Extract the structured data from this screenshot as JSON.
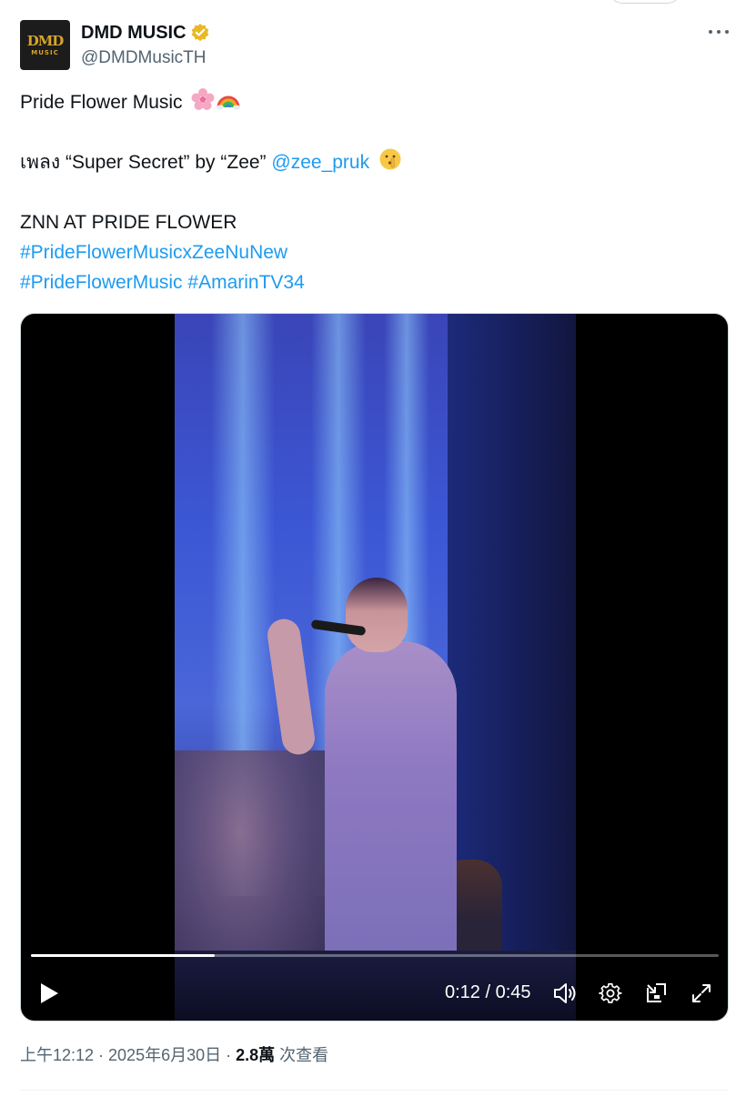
{
  "author": {
    "display_name": "DMD MUSIC",
    "handle": "@DMDMusicTH",
    "avatar_logo_top": "DMD",
    "avatar_logo_bottom": "MUSIC",
    "verified_color": "#e8b923"
  },
  "tweet": {
    "line1": "Pride Flower Music",
    "line2_prefix": "เพลง “Super Secret” by “Zee” ",
    "mention": "@zee_pruk",
    "line3": "ZNN AT PRIDE FLOWER",
    "hashtag1": "#PrideFlowerMusicxZeeNuNew",
    "hashtag2": "#PrideFlowerMusic",
    "hashtag3": "#AmarinTV34",
    "emojis": [
      "cherry-blossom-emoji",
      "rainbow-emoji",
      "shushing-face-emoji"
    ]
  },
  "video": {
    "time_display": "0:12 / 0:45",
    "progress_fraction": 0.267,
    "controls": [
      "play-icon",
      "volume-icon",
      "settings-gear-icon",
      "picture-in-picture-icon",
      "fullscreen-icon"
    ]
  },
  "meta": {
    "timestamp": "上午12:12 · 2025年6月30日 · ",
    "views_count": "2.8萬",
    "views_label": " 次查看"
  },
  "colors": {
    "link": "#1d9bf0",
    "text": "#0f1419",
    "secondary": "#536471"
  }
}
